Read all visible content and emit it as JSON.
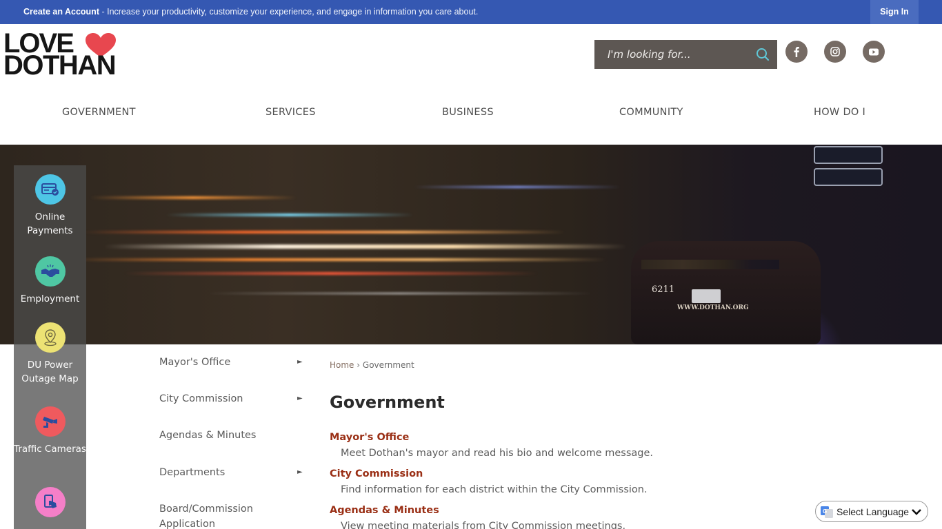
{
  "topbar": {
    "create_account_label": "Create an Account",
    "message": " - Increase your productivity, customize your experience, and engage in information you care about.",
    "sign_in_label": "Sign In"
  },
  "header": {
    "logo_line1": "LOVE",
    "logo_line2": "DOTHAN",
    "search_placeholder": "I'm looking for...",
    "social": [
      {
        "name": "facebook",
        "icon": "facebook-icon"
      },
      {
        "name": "instagram",
        "icon": "instagram-icon"
      },
      {
        "name": "youtube",
        "icon": "youtube-icon"
      }
    ]
  },
  "main_nav": [
    {
      "label": "GOVERNMENT"
    },
    {
      "label": "SERVICES"
    },
    {
      "label": "BUSINESS"
    },
    {
      "label": "COMMUNITY"
    },
    {
      "label": "HOW DO I"
    }
  ],
  "hero": {
    "car_number": "6211",
    "car_url": "WWW.DOTHAN.ORG"
  },
  "quick_links": [
    {
      "label": "Online Payments",
      "icon": "credit-card-icon",
      "color": "#4ec6e6"
    },
    {
      "label": "Employment",
      "icon": "handshake-icon",
      "color": "#4fc7a3"
    },
    {
      "label": "DU Power Outage Map",
      "icon": "map-pin-icon",
      "color": "#ece274"
    },
    {
      "label": "Traffic Cameras",
      "icon": "security-camera-icon",
      "color": "#ef5a5e"
    },
    {
      "label": "",
      "icon": "mobile-tap-icon",
      "color": "#f57fc8"
    }
  ],
  "sub_nav": [
    {
      "label": "Mayor's Office",
      "has_submenu": true
    },
    {
      "label": "City Commission",
      "has_submenu": true
    },
    {
      "label": "Agendas & Minutes",
      "has_submenu": false
    },
    {
      "label": "Departments",
      "has_submenu": true
    },
    {
      "label": "Board/Commission Application",
      "has_submenu": false
    }
  ],
  "breadcrumb": {
    "home": "Home",
    "separator": "›",
    "current": "Government"
  },
  "content": {
    "title": "Government",
    "entries": [
      {
        "title": "Mayor's Office",
        "description": "Meet Dothan's mayor and read his bio and welcome message."
      },
      {
        "title": "City Commission",
        "description": "Find information for each district within the City Commission."
      },
      {
        "title": "Agendas & Minutes",
        "description": "View meeting materials from City Commission meetings."
      }
    ]
  },
  "language": {
    "label": "Select Language"
  },
  "colors": {
    "topbar": "#3558b2",
    "accent_link": "#9a2f15",
    "search_bg": "#5d5753",
    "social_bg": "#766b64",
    "search_icon": "#5fc7d6"
  }
}
